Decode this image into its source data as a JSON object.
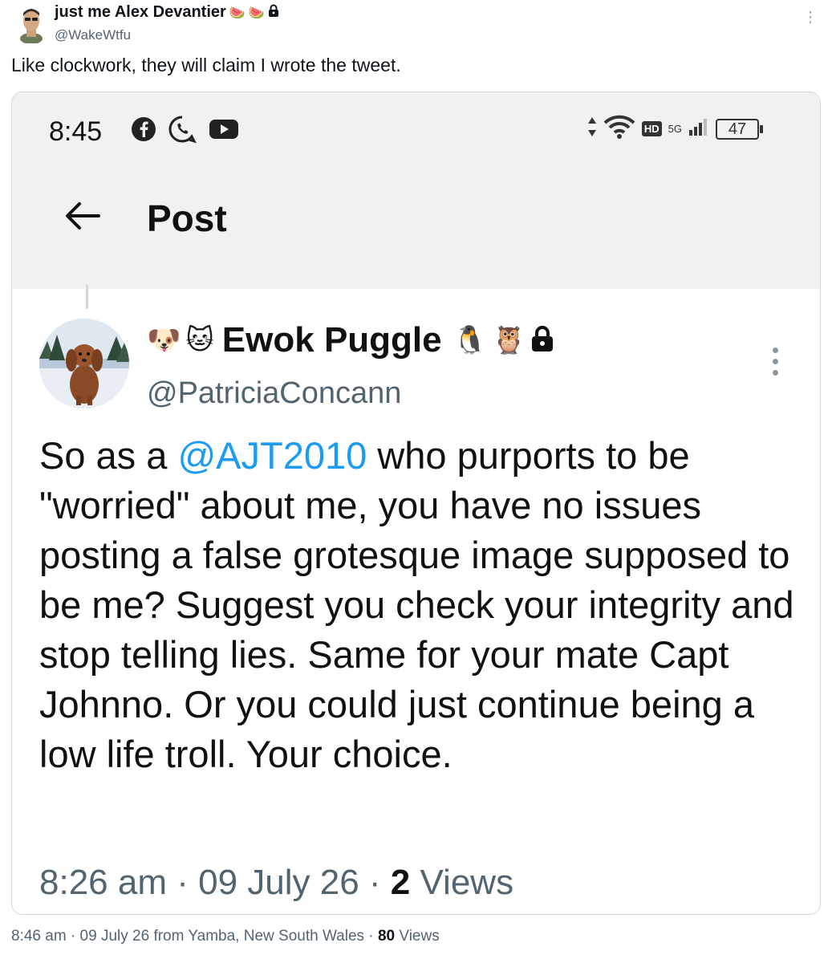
{
  "outer_tweet": {
    "display_name": "just me Alex Devantier",
    "name_emojis": [
      "🍉",
      "🍉"
    ],
    "handle": "@WakeWtfu",
    "text": "Like clockwork, they will claim I wrote the tweet.",
    "footer": {
      "time": "8:46 am",
      "date": "09 July 26",
      "location": "from Yamba, New South Wales",
      "views_count": "80",
      "views_label": "Views"
    }
  },
  "screenshot": {
    "status_bar": {
      "time": "8:45",
      "app_icons": [
        "facebook-icon",
        "whatsapp-icon",
        "youtube-icon"
      ],
      "network_badge": "HD",
      "network_type": "5G",
      "battery": "47"
    },
    "header": {
      "title": "Post"
    },
    "tweet": {
      "leading_emojis": [
        "🐶",
        "🐱"
      ],
      "display_name": "Ewok Puggle",
      "trailing_emojis": [
        "🐧",
        "🦉"
      ],
      "handle": "@PatriciaConcann",
      "text_before_mention": "So as a ",
      "mention": "@AJT2010",
      "text_after_mention": " who purports to  be \"worried\" about me, you have no issues posting a false grotesque image supposed to be me? Suggest you check your integrity and stop telling lies. Same for your mate Capt Johnno. Or you could just continue being a low life troll. Your choice.",
      "time": "8:26 am",
      "date": "09 July 26",
      "views_count": "2",
      "views_label": "Views"
    }
  },
  "colors": {
    "link": "#1d9bf0",
    "secondary_text": "#536471",
    "border": "#cfd9de"
  }
}
